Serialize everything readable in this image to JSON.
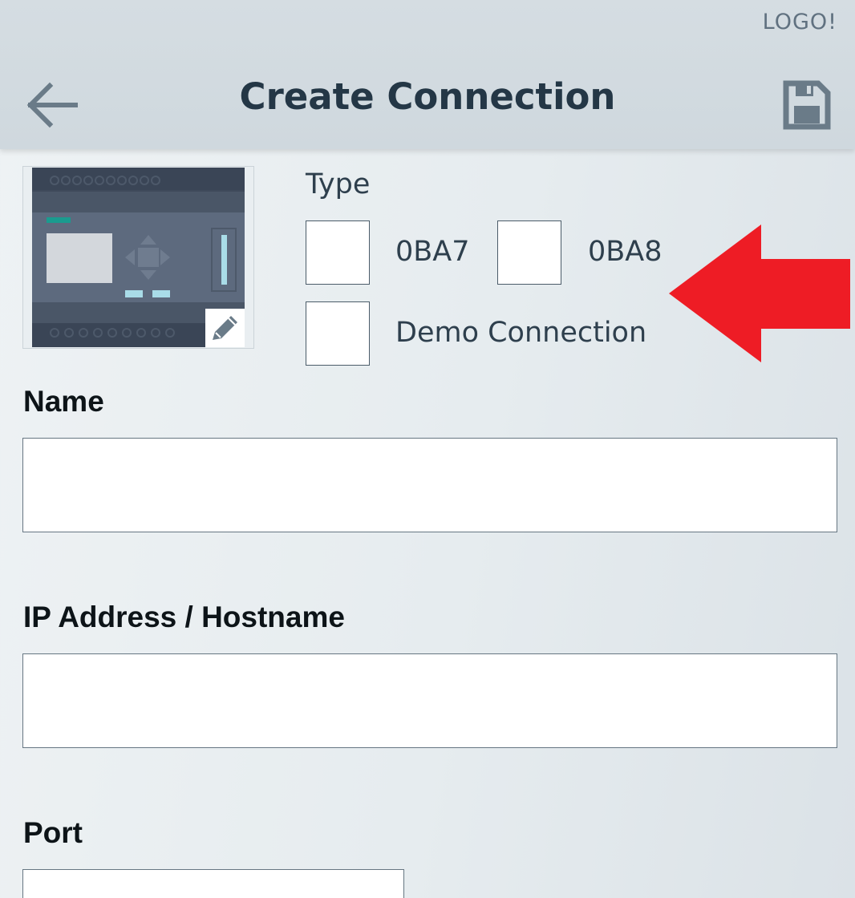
{
  "header": {
    "brand": "LOGO!",
    "title": "Create Connection",
    "back_icon": "arrow-left-icon",
    "save_icon": "floppy-disk-icon"
  },
  "device": {
    "image_icon": "plc-device-icon",
    "edit_icon": "pencil-icon"
  },
  "type_section": {
    "label": "Type",
    "options": [
      {
        "label": "0BA7",
        "checked": false
      },
      {
        "label": "0BA8",
        "checked": false
      },
      {
        "label": "Demo Connection",
        "checked": false
      }
    ]
  },
  "annotation": {
    "arrow_icon": "red-arrow-left-icon",
    "color": "#ee1c25"
  },
  "form": {
    "name_label": "Name",
    "name_value": "",
    "ip_label": "IP Address / Hostname",
    "ip_value": "",
    "port_label": "Port",
    "port_value": ""
  },
  "colors": {
    "header_bg": "#d3dbe0",
    "title_text": "#243746",
    "icon": "#6a7b88",
    "accent_teal": "#1a9b8f",
    "indicator": "#a9dce8"
  }
}
